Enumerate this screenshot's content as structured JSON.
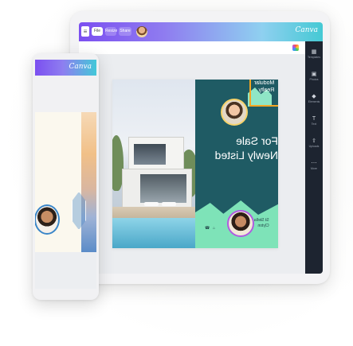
{
  "app": {
    "logo": "Canva"
  },
  "topbar": {
    "menu_icon": "hamburger-icon",
    "file_label": "File",
    "resize_label": "Resize",
    "share_label": "Share"
  },
  "colors": {
    "brand_gradient_start": "#7b4ff0",
    "brand_gradient_end": "#45c9d4",
    "toolbar_dark": "#1d2430",
    "design_teal": "#1f5b64",
    "design_mint": "#7ee3b8",
    "selection_orange": "#f5a623"
  },
  "toolbar": {
    "items": [
      {
        "icon": "templates-icon",
        "label": "Templates"
      },
      {
        "icon": "photos-icon",
        "label": "Photos"
      },
      {
        "icon": "elements-icon",
        "label": "Elements"
      },
      {
        "icon": "text-icon",
        "label": "Text"
      },
      {
        "icon": "uploads-icon",
        "label": "Uploads"
      },
      {
        "icon": "more-icon",
        "label": "More"
      }
    ]
  },
  "design": {
    "logo_line1": "Modular",
    "logo_line2": "Realty",
    "headline_line1": "For Sale",
    "headline_line2": "Newly Listed",
    "contact_line1": "St Stella",
    "contact_line2": "Clyton"
  }
}
